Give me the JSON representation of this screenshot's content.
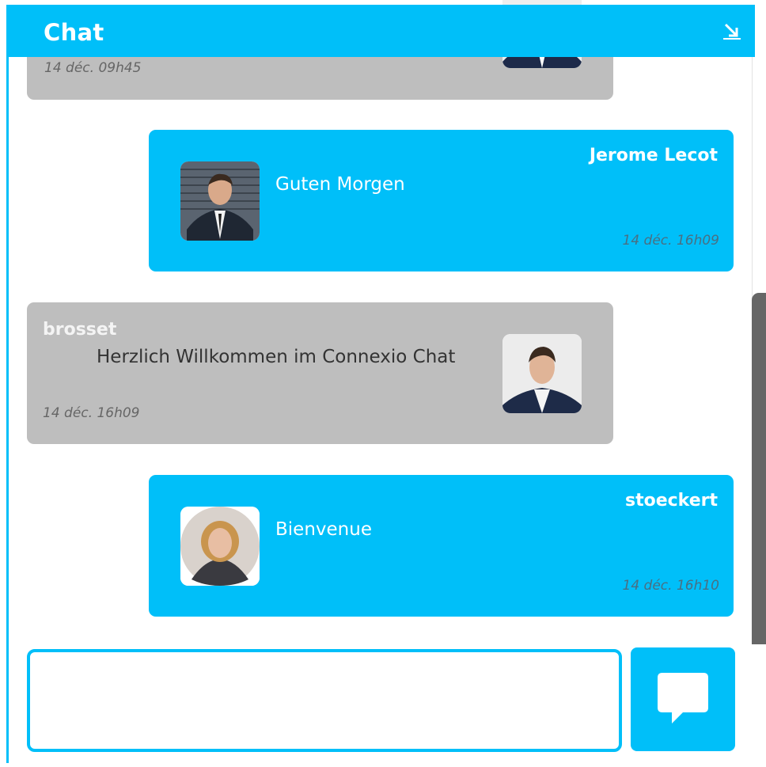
{
  "header": {
    "title": "Chat",
    "minimize_icon": "arrow-down-right-icon"
  },
  "colors": {
    "accent": "#00bff9",
    "bubble_other": "#bebebe",
    "scroll_thumb": "#666666"
  },
  "messages": [
    {
      "side": "them",
      "sender": "",
      "text": "",
      "time": "14 déc. 09h45"
    },
    {
      "side": "me",
      "sender": "Jerome Lecot",
      "text": "Guten Morgen",
      "time": "14 déc. 16h09"
    },
    {
      "side": "them",
      "sender": "brosset",
      "text": "Herzlich Willkommen im Connexio Chat",
      "time": "14 déc. 16h09"
    },
    {
      "side": "me",
      "sender": "stoeckert",
      "text": "Bienvenue",
      "time": "14 déc. 16h10"
    }
  ],
  "composer": {
    "value": "",
    "placeholder": ""
  },
  "send": {
    "icon": "speech-bubble-icon"
  }
}
